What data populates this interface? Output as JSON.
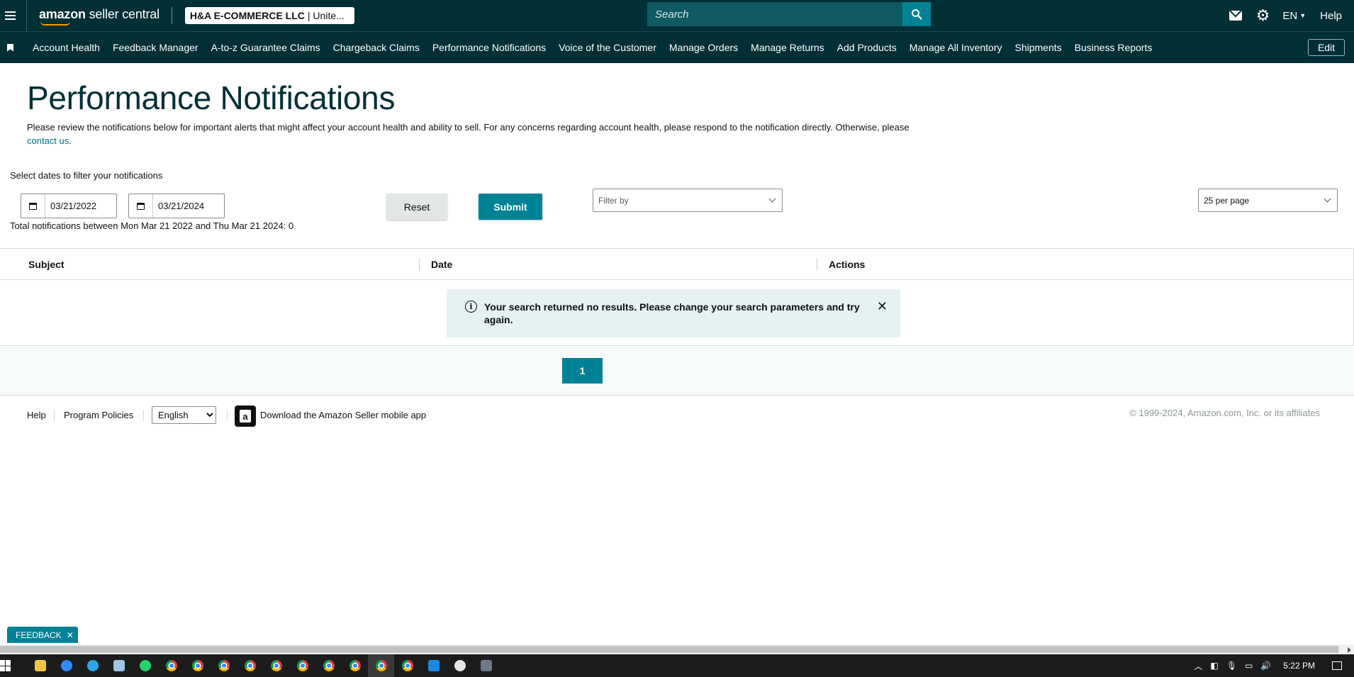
{
  "header": {
    "logo_bold": "amazon",
    "logo_rest": " seller central",
    "account_name": "H&A E-COMMERCE LLC",
    "account_region": "| Unite...",
    "search_placeholder": "Search",
    "language": "EN",
    "help": "Help"
  },
  "nav": {
    "items": [
      {
        "label": "Account Health"
      },
      {
        "label": "Feedback Manager"
      },
      {
        "label": "A-to-z Guarantee Claims"
      },
      {
        "label": "Chargeback Claims"
      },
      {
        "label": "Performance Notifications"
      },
      {
        "label": "Voice of the Customer"
      },
      {
        "label": "Manage Orders"
      },
      {
        "label": "Manage Returns"
      },
      {
        "label": "Add Products"
      },
      {
        "label": "Manage All Inventory"
      },
      {
        "label": "Shipments"
      },
      {
        "label": "Business Reports"
      }
    ],
    "edit": "Edit"
  },
  "page": {
    "title": "Performance Notifications",
    "desc_main": "Please review the notifications below for important alerts that might affect your account health and ability to sell. For any concerns regarding account health, please respond to the notification directly. Otherwise, please ",
    "desc_link": "contact us",
    "desc_end": "."
  },
  "filters": {
    "label": "Select dates to filter your notifications",
    "start_date": "03/21/2022",
    "end_date": "03/21/2024",
    "total_text": "Total notifications between Mon Mar 21 2022 and Thu Mar 21 2024: 0",
    "reset": "Reset",
    "submit": "Submit",
    "filter_by": "Filter by",
    "per_page": "25 per page"
  },
  "table": {
    "columns": [
      "Subject",
      "Date",
      "Actions"
    ],
    "alert": "Your search returned no results. Please change your search parameters and try again."
  },
  "pagination": {
    "current_page": "1"
  },
  "footer": {
    "help": "Help",
    "program_policies": "Program Policies",
    "language_option": "English",
    "download_app": "Download the Amazon Seller mobile app",
    "copyright": "© 1999-2024, Amazon.com, Inc. or its affiliates"
  },
  "feedback": {
    "label": "FEEDBACK"
  },
  "taskbar": {
    "time": "5:22 PM"
  },
  "colors": {
    "header_bg": "#002f36",
    "accent": "#008296",
    "link": "#007185",
    "alert_bg": "#e6f1f2"
  }
}
